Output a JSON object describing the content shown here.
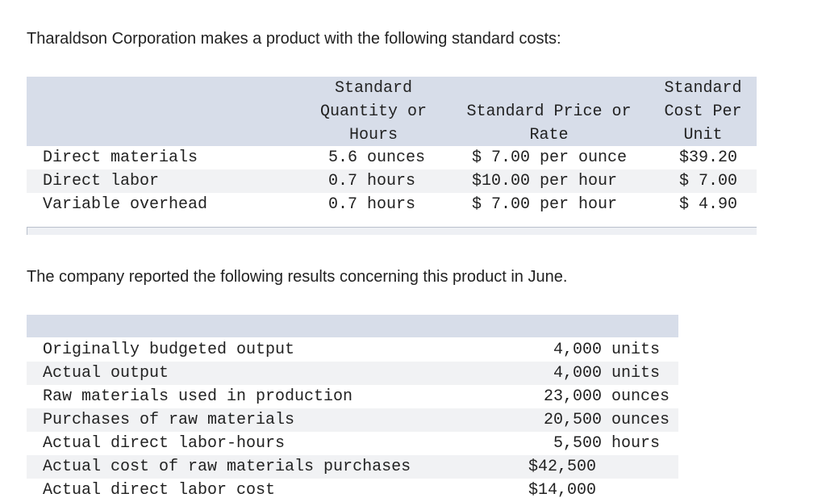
{
  "intro1": "Tharaldson Corporation makes a product with the following standard costs:",
  "table1": {
    "headers": {
      "quantity": [
        "Standard",
        "Quantity or",
        "Hours"
      ],
      "price": [
        "Standard Price or",
        "Rate"
      ],
      "cost": [
        "Standard",
        "Cost Per",
        "Unit"
      ]
    },
    "rows": [
      {
        "item": "Direct materials",
        "quantity": "5.6 ounces",
        "price": "$ 7.00 per ounce",
        "cost": "$39.20"
      },
      {
        "item": "Direct labor",
        "quantity": "0.7 hours",
        "price": "$10.00 per hour",
        "cost": "$ 7.00"
      },
      {
        "item": "Variable overhead",
        "quantity": "0.7 hours",
        "price": "$ 7.00 per hour",
        "cost": "$ 4.90"
      }
    ]
  },
  "intro2": "The company reported the following results concerning this product in June.",
  "table2": {
    "rows": [
      {
        "label": "Originally budgeted output",
        "value": "4,000 units"
      },
      {
        "label": "Actual output",
        "value": "4,000 units"
      },
      {
        "label": "Raw materials used in production",
        "value": "23,000 ounces"
      },
      {
        "label": "Purchases of raw materials",
        "value": "20,500 ounces"
      },
      {
        "label": "Actual direct labor-hours",
        "value": "5,500 hours"
      },
      {
        "label": "Actual cost of raw materials purchases",
        "value": "$42,500"
      },
      {
        "label": "Actual direct labor cost",
        "value": "$14,000"
      }
    ]
  }
}
